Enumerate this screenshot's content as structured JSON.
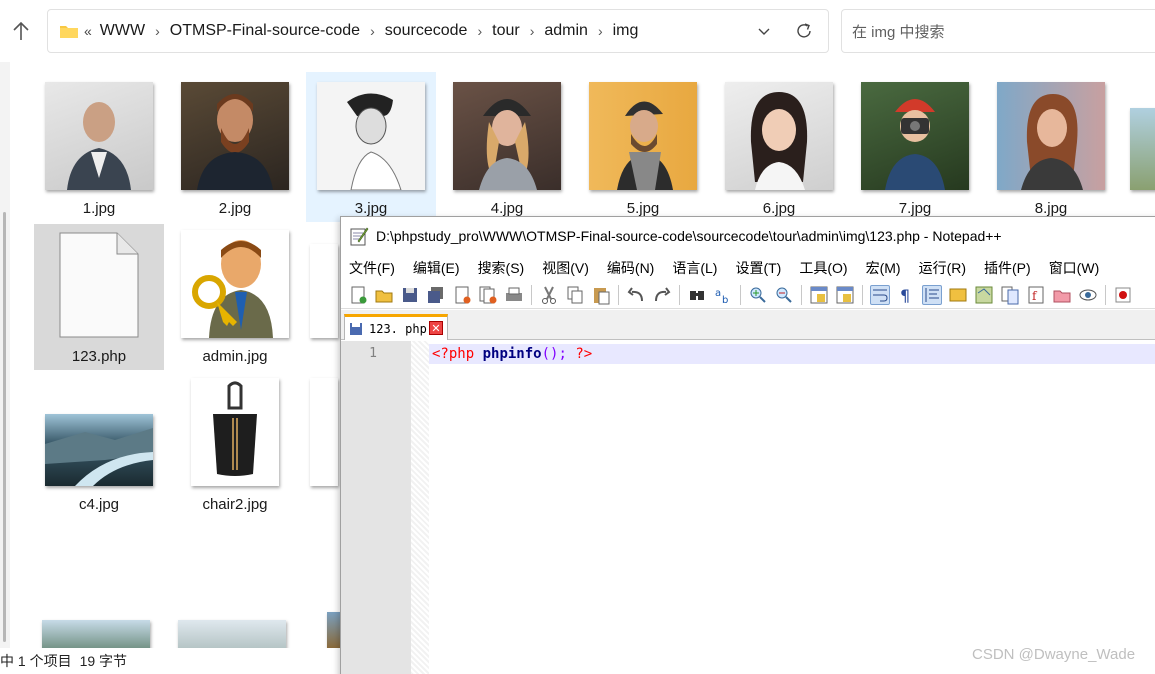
{
  "explorer": {
    "address_overflow": "«",
    "breadcrumbs": [
      "WWW",
      "OTMSP-Final-source-code",
      "sourcecode",
      "tour",
      "admin",
      "img"
    ],
    "search_placeholder": "在 img 中搜索",
    "files": [
      {
        "name": "1.jpg"
      },
      {
        "name": "2.jpg"
      },
      {
        "name": "3.jpg"
      },
      {
        "name": "4.jpg"
      },
      {
        "name": "5.jpg"
      },
      {
        "name": "6.jpg"
      },
      {
        "name": "7.jpg"
      },
      {
        "name": "8.jpg"
      },
      {
        "name": "123.php"
      },
      {
        "name": "admin.jpg"
      },
      {
        "name": "c4.jpg"
      },
      {
        "name": "chair2.jpg"
      }
    ],
    "status": {
      "selected": "中 1 个项目",
      "size": "19 字节"
    }
  },
  "notepad": {
    "title": "D:\\phpstudy_pro\\WWW\\OTMSP-Final-source-code\\sourcecode\\tour\\admin\\img\\123.php - Notepad++",
    "menu": [
      "文件(F)",
      "编辑(E)",
      "搜索(S)",
      "视图(V)",
      "编码(N)",
      "语言(L)",
      "设置(T)",
      "工具(O)",
      "宏(M)",
      "运行(R)",
      "插件(P)",
      "窗口(W)"
    ],
    "tab_label": "123. php",
    "line_number": "1",
    "code": {
      "open": "<?php",
      "fn": "phpinfo",
      "parens": "()",
      "semi": ";",
      "close": "?>"
    }
  },
  "watermark": "CSDN @Dwayne_Wade",
  "colors": {
    "accent": "#0078d4",
    "selected": "#d9d9d9",
    "hover": "#e5f3ff",
    "line_highlight": "#e8e8ff"
  }
}
